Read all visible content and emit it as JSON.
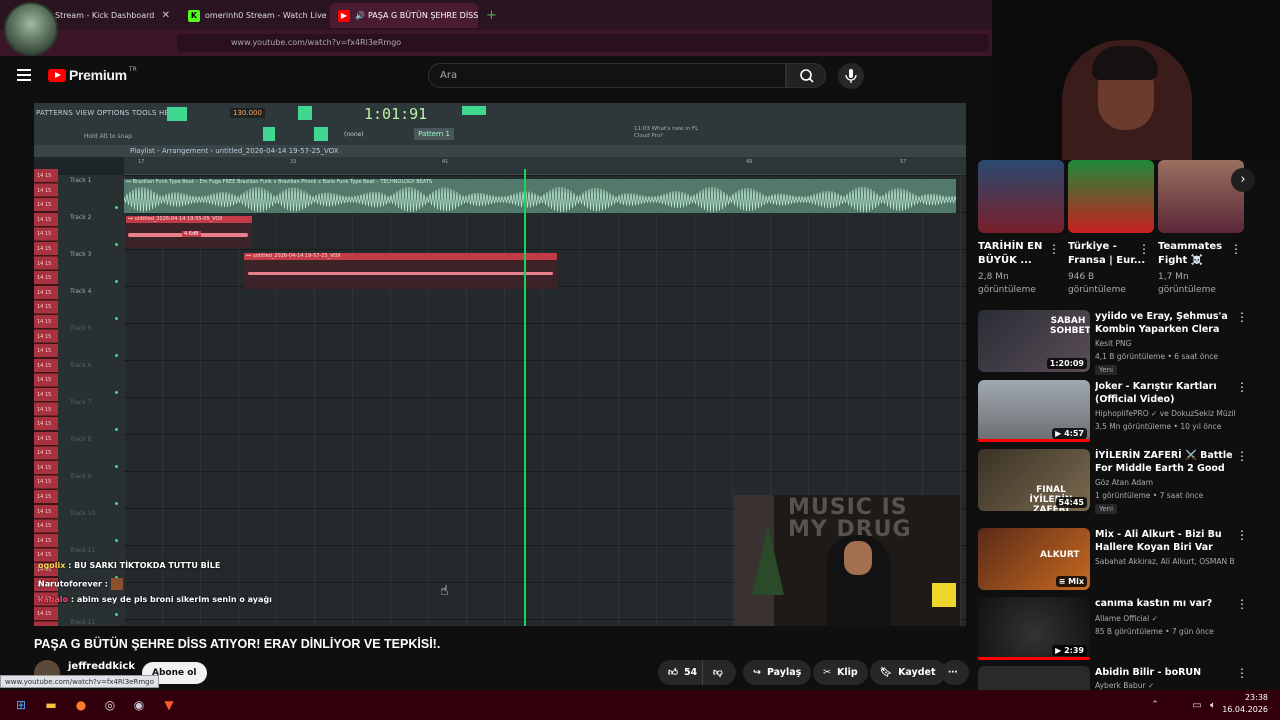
{
  "browser": {
    "tabs": [
      {
        "label": "Stream - Kick Dashboard",
        "icon": "kick-icon",
        "active": false
      },
      {
        "label": "omerinh0 Stream - Watch Live o",
        "icon": "kick-icon",
        "active": false
      },
      {
        "label": "PAŞA G BÜTÜN ŞEHRE DİSS",
        "icon": "youtube-icon",
        "active": true
      }
    ],
    "url": "www.youtube.com/watch?v=fx4Rl3eRmgo",
    "status_url": "www.youtube.com/watch?v=fx4Rl3eRmgo"
  },
  "youtube": {
    "logo_text": "Premium",
    "logo_sup": "TR",
    "search_placeholder": "Ara"
  },
  "fl": {
    "menu": "PATTERNS VIEW OPTIONS TOOLS HELP",
    "bpm": "130.000",
    "time": "1:01:91",
    "hint": "Hold Alt to snap",
    "pattern": "Pattern 1",
    "none": "(none)",
    "whats_new": "11:03 What's new in FL Cloud Pro?",
    "playlist_title": "Playlist - Arrangement › untitled_2026-04-14 19-57-25_VOX",
    "ruler": [
      "17",
      "33",
      "41",
      "49",
      "57"
    ],
    "tracks": [
      "Track 1",
      "Track 2",
      "Track 3",
      "Track 4",
      "Track 5",
      "Track 6",
      "Track 7",
      "Track 8",
      "Track 9",
      "Track 10",
      "Track 11",
      "Track 11"
    ],
    "clip1_label": "⊶ Brazilian Funk Type Beat – Em Fuga  FREE Brazilian Funk x Brazilian Phonk x Baile Funk Type Beat – TECHNOLOGY BEATS",
    "clip2_label": "⊶ untitled_2026-04-14 19-55-05_VOX",
    "clip2_vol": "4.6dB",
    "clip3_label": "⊶ untitled_2026-04-14 19-57-25_VOX",
    "key_label": "14 15"
  },
  "chat": [
    {
      "user": "ogolix",
      "text": ": BU SARKI TİKTOKDA TUTTU BİLE"
    },
    {
      "user": "Narutoforever",
      "text": ":"
    },
    {
      "user": "kabalo",
      "text": ": abim sey de pls broni sikerim senin o ayağı"
    }
  ],
  "cam_text": "MUSIC IS MY DRUG",
  "video": {
    "title": "PAŞA G BÜTÜN ŞEHRE DİSS ATIYOR! ERAY DİNLİYOR VE TEPKİSİ!.",
    "channel": "jeffreddkick",
    "subscribe": "Abone ol",
    "likes": "54",
    "share": "Paylaş",
    "clip": "Klip",
    "save": "Kaydet"
  },
  "shorts": [
    {
      "title": "TARİHİN EN BÜYÜK ...",
      "views": "2,8 Mn görüntüleme",
      "color": "#7a1f2a"
    },
    {
      "title": "Türkiye - Fransa | Eur...",
      "views": "946 B görüntüleme",
      "color": "#c8201f"
    },
    {
      "title": "Teammates Fight ☠️",
      "views": "1,7 Mn görüntüleme",
      "color": "#5a2838"
    }
  ],
  "recommended": [
    {
      "title": "yyiido ve Eray, Şehmus'a Kombin Yaparken Clera Geliyo...",
      "channel": "Kesit PNG",
      "meta": "4,1 B görüntüleme • 6 saat önce",
      "badge": "Yeni",
      "duration": "1:20:09",
      "color": "#3a3d46"
    },
    {
      "title": "Joker - Karıştır Kartları (Official Video)",
      "channel": "HiphoplifePRO ✓ ve DokuzSekiz Müzik...",
      "meta": "3,5 Mn görüntüleme • 10 yıl önce",
      "badge": "",
      "duration": "4:57",
      "color": "#8a8f94"
    },
    {
      "title": "İYİLERİN ZAFERİ ⚔️ Battle For Middle Earth 2 Good Campaig...",
      "channel": "Göz Atan Adam",
      "meta": "1 görüntüleme • 7 saat önce",
      "badge": "Yeni",
      "duration": "54:45",
      "color": "#4e4636"
    },
    {
      "title": "Mix - Ali Alkurt - Bizi Bu Hallere Koyan Biri Var",
      "channel": "Sabahat Akkiraz, Ali Alkurt, OSMAN BER...",
      "meta": "",
      "badge": "",
      "duration": "Mix",
      "color": "#5a2a18"
    },
    {
      "title": "canıma kastın mı var?",
      "channel": "Allame Official ✓",
      "meta": "85 B görüntüleme • 7 gün önce",
      "badge": "",
      "duration": "2:39",
      "color": "#1c1c1c"
    },
    {
      "title": "Abidin Bilir - boRUN",
      "channel": "Ayberk Babur ✓",
      "meta": "",
      "badge": "",
      "duration": "",
      "color": "#2a2a2a"
    }
  ],
  "clock": {
    "time": "23:38",
    "date": "16.04.2026"
  }
}
